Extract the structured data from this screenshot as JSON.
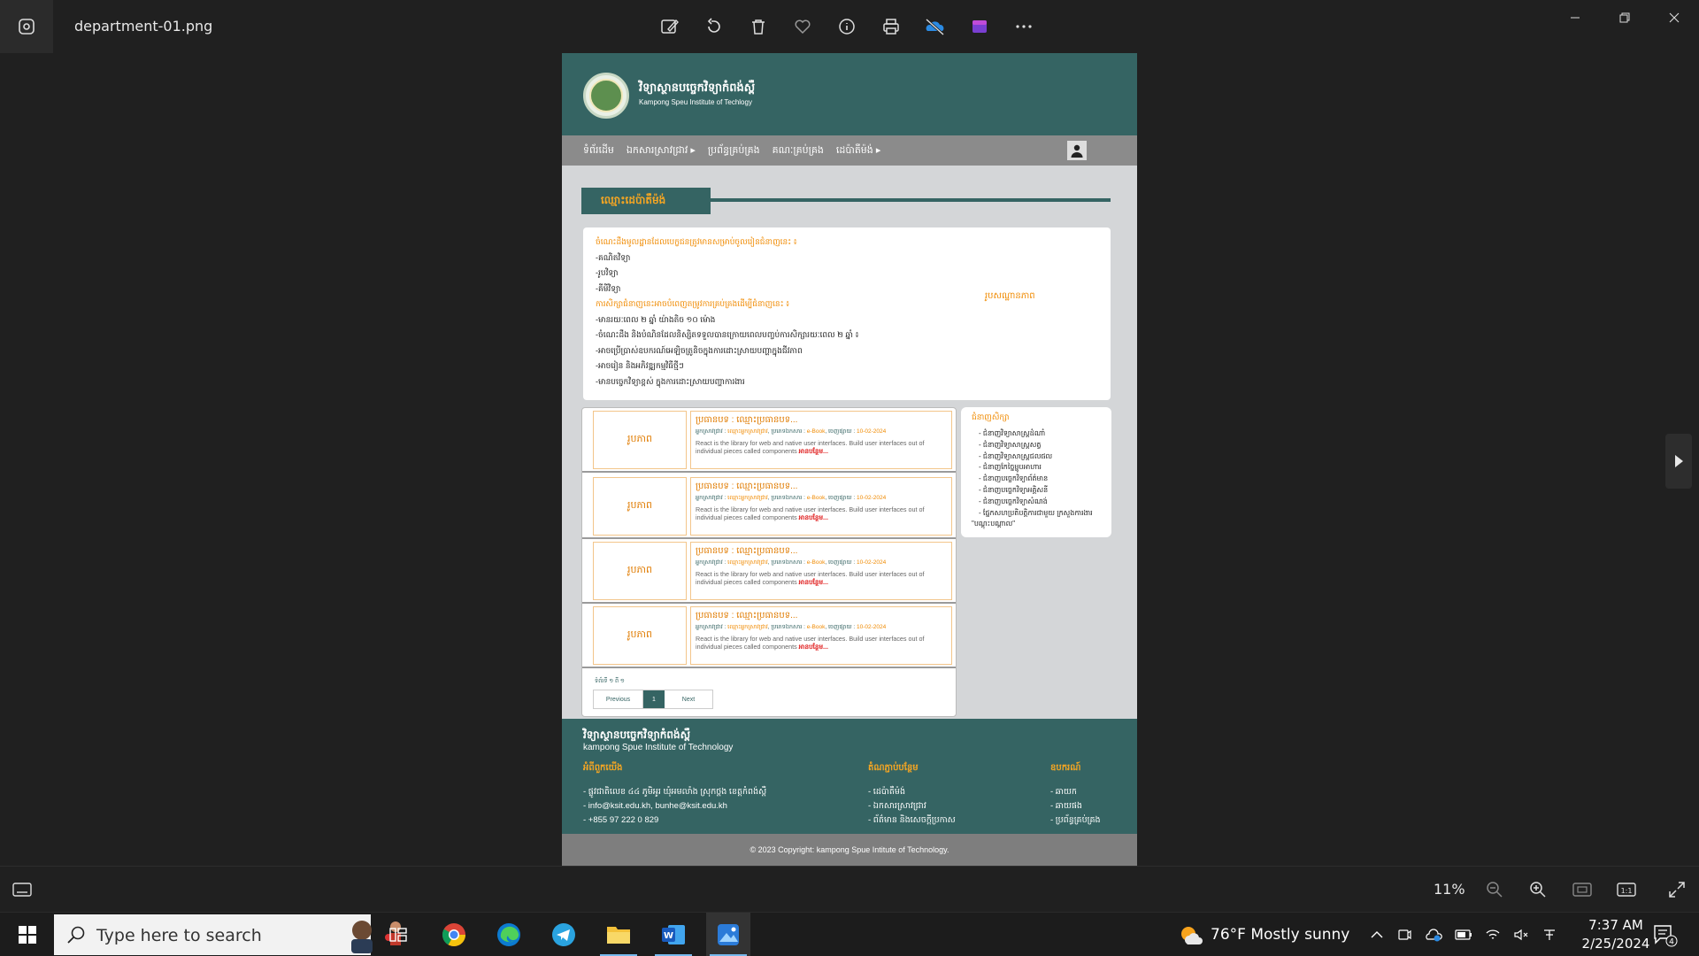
{
  "viewer": {
    "file_name": "department-01.png",
    "zoom": "11%"
  },
  "site": {
    "name_km": "វិទ្យាស្ថានបច្ចេកវិទ្យាកំពង់ស្ពឺ",
    "name_en": "Kampong Speu Institute of Techlogy",
    "nav": [
      "ទំព័រដើម",
      "ឯកសារស្រាវជ្រាវ ▸",
      "ប្រព័ន្ធគ្រប់គ្រង",
      "គណៈគ្រប់គ្រង",
      "ដេប៉ាតឺម៉ង់ ▸"
    ],
    "section_title": "ឈ្មោះដេប៉ាតឺម៉ង់",
    "info_lines": [
      {
        "text": "ចំណេះដឹងមូលដ្ឋានដែលបេក្ខជនត្រូវមានសម្រាប់ចូលរៀនជំនាញនេះ ៖",
        "orange": true
      },
      {
        "text": "-គណិតវិទ្យា",
        "orange": false
      },
      {
        "text": "-រូបវិទ្យា",
        "orange": false
      },
      {
        "text": "-គីមីវិទ្យា",
        "orange": false
      },
      {
        "text": "ការសិក្សាជំនាញនេះអាចបំពេញតម្រូវការគ្រប់គ្រងដើម្បីជំនាញនេះ ៖",
        "orange": true
      },
      {
        "text": "-មានរយៈពេល ២ ឆ្នាំ យ៉ាងតិច ១០ ម៉ោង",
        "orange": false
      },
      {
        "text": "-ចំណេះដឹង និងបំណិនដែលនិស្សិតទទួលបានក្រោយពេលបញ្ចប់ការសិក្សារយៈពេល ២ ឆ្នាំ ៖",
        "orange": false
      },
      {
        "text": "-អាចប្រើប្រាស់ឧបករណ៍អេឡិចត្រូនិចក្នុងការដោះស្រាយបញ្ហាក្នុងជីវភាព",
        "orange": false
      },
      {
        "text": "-អាចរៀន និងអភិវឌ្ឍកម្មវិធីថ្មីៗ",
        "orange": false
      },
      {
        "text": "-មានបច្ចេកវិទ្យាខ្ពស់ ក្នុងការដោះស្រាយបញ្ហាការងារ",
        "orange": false
      }
    ],
    "info_image_label": "រូបសណ្ឋានភាព",
    "books": [
      {
        "thumb": "រូបភាព",
        "title": "ប្រធានបទ : ឈ្មោះប្រធានបទ...",
        "author_label": "អ្នកស្រាវជ្រាវ :",
        "author": "ឈ្មោះអ្នកស្រាវជ្រាវ",
        "type_label": ", ប្រភេទឯកសារ :",
        "type": "e-Book",
        "date_label": ", ចេញផ្សាយ :",
        "date": "10-02-2024",
        "desc": "React is the library for web and native user interfaces. Build user interfaces out of individual pieces called components",
        "more": "អានបន្ថែម..."
      },
      {
        "thumb": "រូបភាព",
        "title": "ប្រធានបទ : ឈ្មោះប្រធានបទ...",
        "author_label": "អ្នកស្រាវជ្រាវ :",
        "author": "ឈ្មោះអ្នកស្រាវជ្រាវ",
        "type_label": ", ប្រភេទឯកសារ :",
        "type": "e-Book",
        "date_label": ", ចេញផ្សាយ :",
        "date": "10-02-2024",
        "desc": "React is the library for web and native user interfaces. Build user interfaces out of individual pieces called components",
        "more": "អានបន្ថែម..."
      },
      {
        "thumb": "រូបភាព",
        "title": "ប្រធានបទ : ឈ្មោះប្រធានបទ...",
        "author_label": "អ្នកស្រាវជ្រាវ :",
        "author": "ឈ្មោះអ្នកស្រាវជ្រាវ",
        "type_label": ", ប្រភេទឯកសារ :",
        "type": "e-Book",
        "date_label": ", ចេញផ្សាយ :",
        "date": "10-02-2024",
        "desc": "React is the library for web and native user interfaces. Build user interfaces out of individual pieces called components",
        "more": "អានបន្ថែម..."
      },
      {
        "thumb": "រូបភាព",
        "title": "ប្រធានបទ : ឈ្មោះប្រធានបទ...",
        "author_label": "អ្នកស្រាវជ្រាវ :",
        "author": "ឈ្មោះអ្នកស្រាវជ្រាវ",
        "type_label": ", ប្រភេទឯកសារ :",
        "type": "e-Book",
        "date_label": ", ចេញផ្សាយ :",
        "date": "10-02-2024",
        "desc": "React is the library for web and native user interfaces. Build user interfaces out of individual pieces called components",
        "more": "អានបន្ថែម..."
      }
    ],
    "pager": {
      "count_text": "ទំព័រទី ១ ពី ១",
      "prev": "Previous",
      "current": "1",
      "next": "Next"
    },
    "subjects": {
      "title": "ជំនាញសិក្សា",
      "items": [
        "- ជំនាញវិទ្យាសាស្ត្រដំណាំ",
        "- ជំនាញវិទ្យាសាស្ត្រសត្វ",
        "- ជំនាញវិទ្យាសាស្ត្រជលផល",
        "- ជំនាញកែច្នៃម្ហូបអាហារ",
        "- ជំនាញបច្ចេកវិទ្យាព័ត៌មាន",
        "- ជំនាញបច្ចេកវិទ្យាអគ្គិសនី",
        "- ជំនាញបច្ចេកវិទ្យាសំណង់",
        "- ផ្នែកសហប្រតិបត្តិការជាមួយ ក្រសួងការងារ",
        "\"បណ្ដុះបណ្ដាល\""
      ]
    },
    "footer": {
      "name_km": "វិទ្យាស្ថានបច្ចេកវិទ្យាកំពង់ស្ពឺ",
      "name_en": "kampong Spue Institute of Technology",
      "contact_head": "អំពីពួកយើង",
      "contact": [
        "- ផ្លូវជាតិលេខ ៤៤ ភូមិអូរ ឃុំអមលាំង ស្រុកថ្ពង ខេត្តកំពង់ស្ពឺ",
        "- info@ksit.edu.kh, bunhe@ksit.edu.kh",
        "- +855 97 222 0 829"
      ],
      "links_head": "តំណភ្ជាប់បន្ថែម",
      "links": [
        "- ដេប៉ាតឺម៉ង់",
        "- ឯកសារស្រាវជ្រាវ",
        "- ព័ត៌មាន និងសេចក្ដីប្រកាស"
      ],
      "tools_head": "ឧបករណ៍",
      "tools": [
        "- ឆាយក",
        "- ឆាយផង",
        "- ប្រព័ន្ធគ្រប់គ្រង"
      ],
      "copyright": "© 2023 Copyright: kampong Spue Intitute of Technology."
    }
  },
  "taskbar": {
    "search_placeholder": "Type here to search",
    "weather": "76°F  Mostly sunny",
    "time": "7:37 AM",
    "date": "2/25/2024",
    "notifications": "4"
  },
  "colors": {
    "brand_teal": "#356463",
    "accent_orange": "#f08a00",
    "nav_gray": "#8b8b8b"
  }
}
